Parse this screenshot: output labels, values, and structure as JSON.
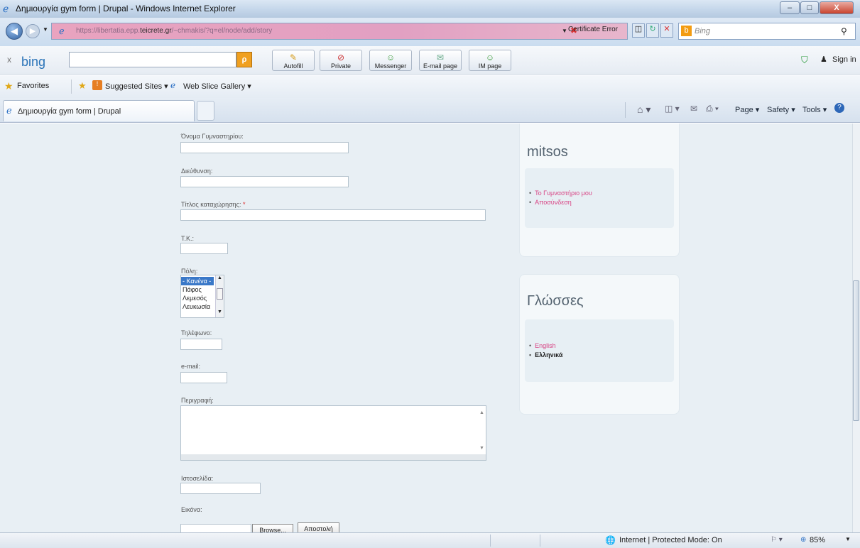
{
  "window": {
    "title": "Δημιουργία gym form | Drupal - Windows Internet Explorer",
    "minimize": "–",
    "maximize": "□",
    "close": "X"
  },
  "address": {
    "url_prefix": "https://libertatia.epp.",
    "url_domain": "teicrete.gr",
    "url_suffix": "/~chmakis/?q=el/node/add/story",
    "cert_error": "Certificate Error",
    "search_placeholder": "Bing"
  },
  "bingbar": {
    "close": "x",
    "brand": "bing",
    "buttons": [
      "Autofill",
      "Private",
      "Messenger",
      "E-mail page",
      "IM page"
    ],
    "signin": "Sign in"
  },
  "favorites": {
    "favorites": "Favorites",
    "suggested": "Suggested Sites ▾",
    "webslice": "Web Slice Gallery ▾"
  },
  "tab": {
    "title": "Δημιουργία gym form | Drupal"
  },
  "commands": {
    "page": "Page ▾",
    "safety": "Safety ▾",
    "tools": "Tools ▾"
  },
  "form": {
    "gym_name_label": "Όνομα Γυμναστηρίου:",
    "address_label": "Διεύθυνση:",
    "title_label": "Τίτλος καταχώρησης:",
    "required_mark": "*",
    "zip_label": "Τ.Κ.:",
    "city_label": "Πόλη:",
    "city_options": [
      "- Κανένα -",
      "Πάφος",
      "Λεμεσός",
      "Λευκωσία"
    ],
    "phone_label": "Τηλέφωνο:",
    "email_label": "e-mail:",
    "description_label": "Περιγραφή:",
    "website_label": "Ιστοσελίδα:",
    "image_label": "Εικόνα:",
    "browse_button": "Browse...",
    "upload_button": "Αποστολή"
  },
  "user_block": {
    "title": "mitsos",
    "links": [
      "Το Γυμναστήριο μου",
      "Αποσύνδεση"
    ]
  },
  "lang_block": {
    "title": "Γλώσσες",
    "links": [
      "English",
      "Ελληνικά"
    ]
  },
  "status": {
    "zone": "Internet | Protected Mode: On",
    "zoom": "85%"
  }
}
